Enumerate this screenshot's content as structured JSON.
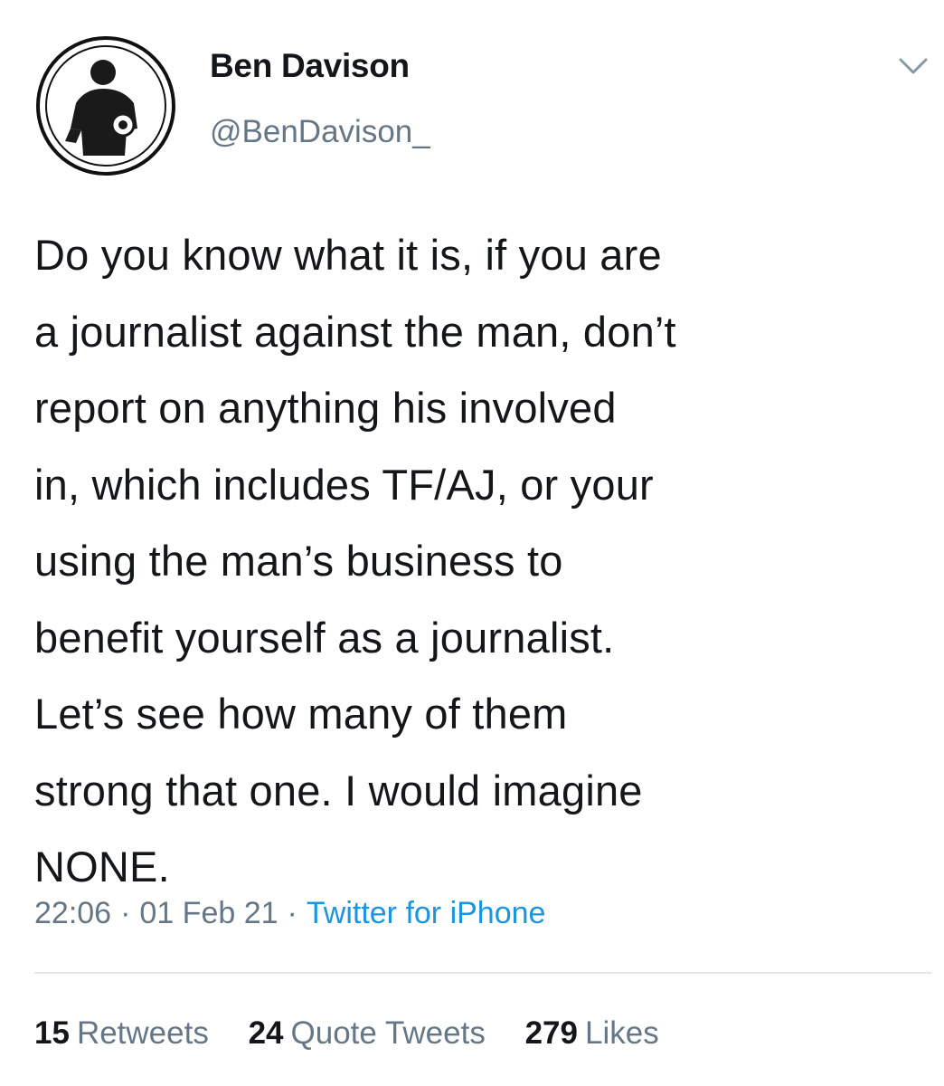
{
  "author": {
    "display_name": "Ben Davison",
    "handle": "@BenDavison_",
    "avatar_icon": "person-silhouette-avatar"
  },
  "header": {
    "more_icon": "chevron-down-icon"
  },
  "tweet": {
    "text": "Do you know what it is, if you are\na journalist against the man, don’t\nreport on anything his involved\nin, which includes TF/AJ, or your\nusing the man’s business to\nbenefit yourself as a journalist.\nLet’s see how many of them\nstrong that one. I would imagine\nNONE.",
    "time": "22:06",
    "date": "01 Feb 21",
    "separator": "·",
    "source": "Twitter for iPhone"
  },
  "stats": {
    "retweets": {
      "count": "15",
      "label": "Retweets"
    },
    "quote_tweets": {
      "count": "24",
      "label": "Quote Tweets"
    },
    "likes": {
      "count": "279",
      "label": "Likes"
    }
  },
  "colors": {
    "text": "#14171a",
    "secondary": "#657786",
    "link": "#1b95e0",
    "divider": "#e1e8ed"
  }
}
